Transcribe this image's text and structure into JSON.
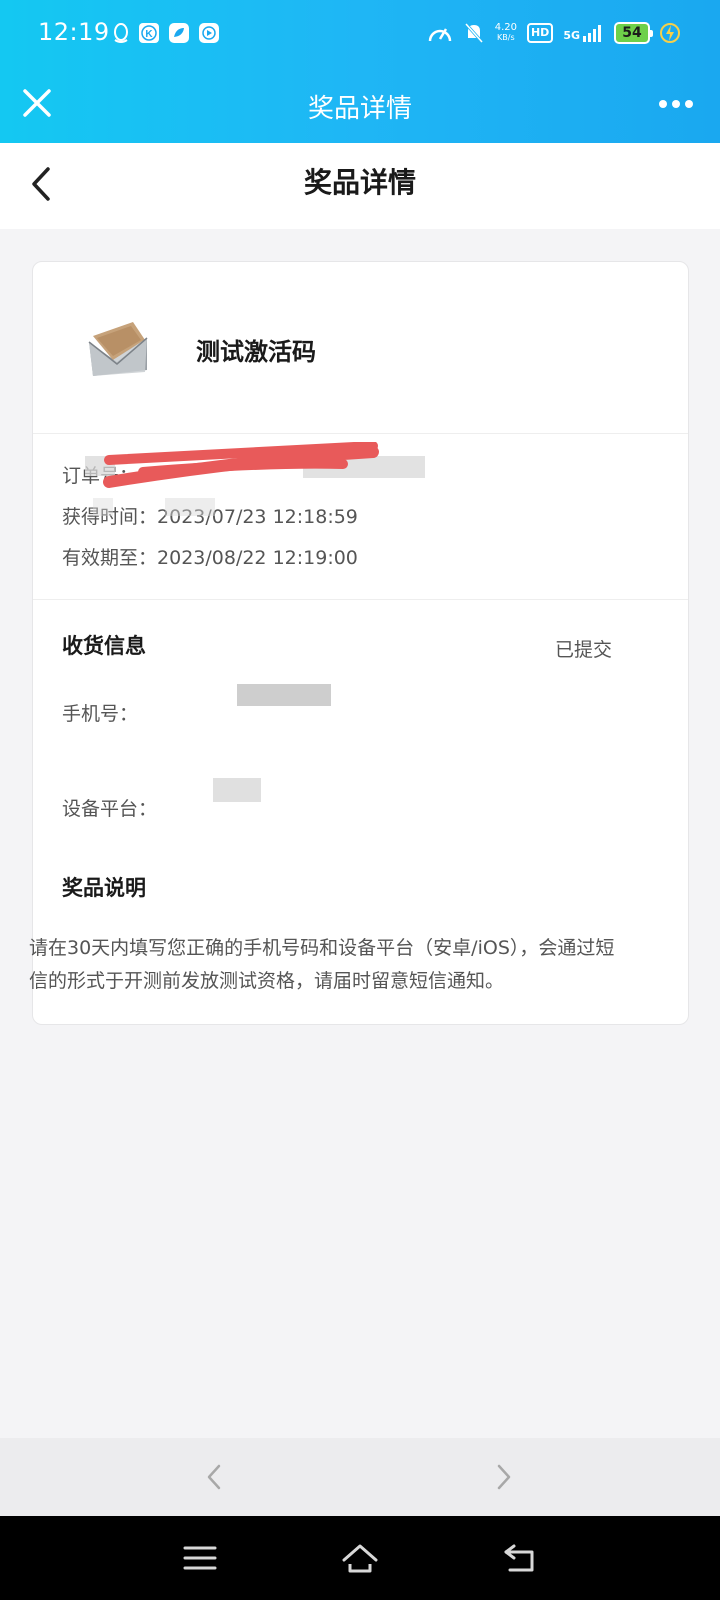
{
  "status_bar": {
    "time": "12:19",
    "net_speed_value": "4.20",
    "net_speed_unit": "KB/s",
    "hd_label": "HD",
    "network_label": "5G",
    "battery_level": "54"
  },
  "title_bar": {
    "title": "奖品详情"
  },
  "page_header": {
    "title": "奖品详情"
  },
  "prize": {
    "name": "测试激活码"
  },
  "order": {
    "order_label": "订单号：",
    "obtained_label": "获得时间：",
    "obtained_value": "2023/07/23 12:18:59",
    "expiry_label": "有效期至：",
    "expiry_value": "2023/08/22 12:19:00"
  },
  "delivery": {
    "title": "收货信息",
    "status": "已提交",
    "phone_label": "手机号：",
    "platform_label": "设备平台："
  },
  "prize_desc": {
    "title": "奖品说明",
    "text": "请在30天内填写您正确的手机号码和设备平台（安卓/iOS），会通过短信的形式于开测前发放测试资格，请届时留意短信通知。"
  },
  "colors": {
    "gradient_start": "#14c8f2",
    "gradient_end": "#1aa8f0",
    "battery": "#6ed04a",
    "redaction": "#e85a5a"
  }
}
